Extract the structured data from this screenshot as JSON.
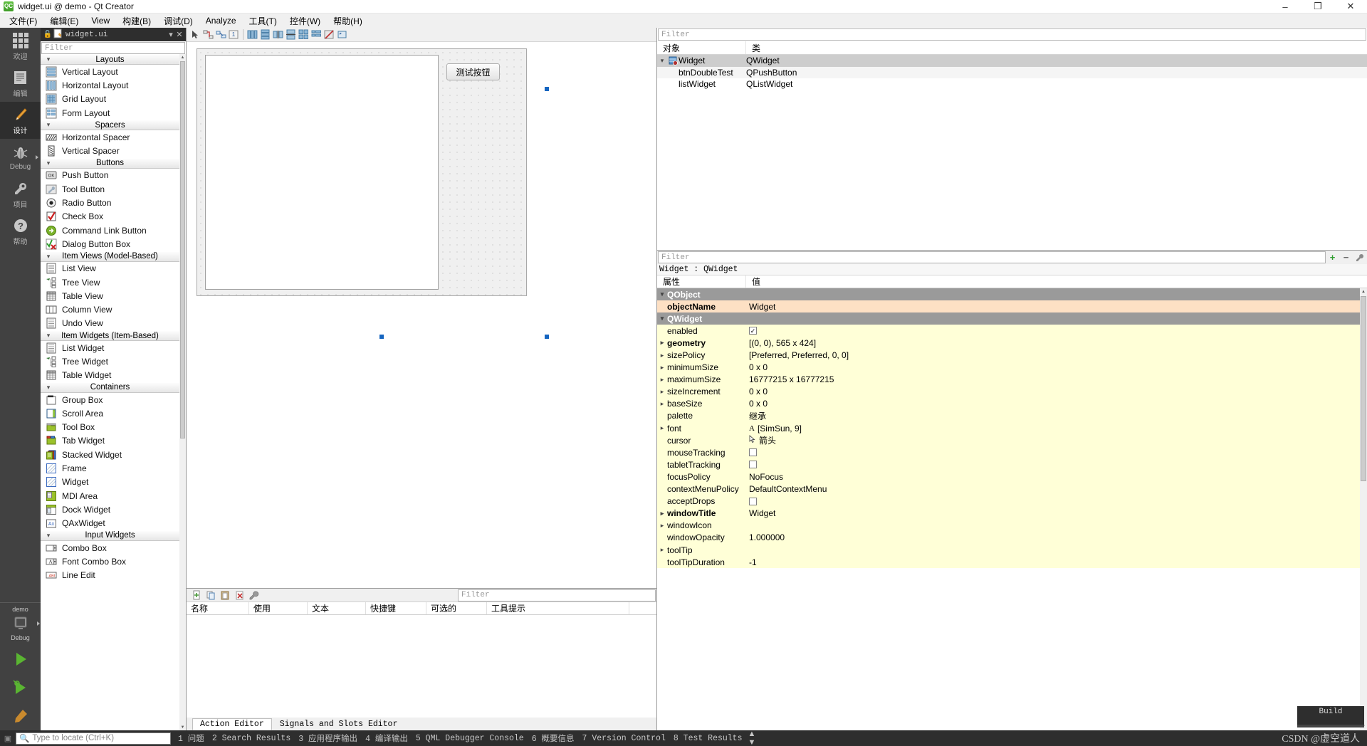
{
  "window": {
    "title": "widget.ui @ demo - Qt Creator",
    "app_icon": "qt-creator-icon",
    "minimize": "–",
    "maximize": "❐",
    "close": "✕"
  },
  "menubar": {
    "items": [
      {
        "label": "文件(F)",
        "name": "menu-file"
      },
      {
        "label": "编辑(E)",
        "name": "menu-edit"
      },
      {
        "label": "View",
        "name": "menu-view"
      },
      {
        "label": "构建(B)",
        "name": "menu-build"
      },
      {
        "label": "调试(D)",
        "name": "menu-debug"
      },
      {
        "label": "Analyze",
        "name": "menu-analyze"
      },
      {
        "label": "工具(T)",
        "name": "menu-tools"
      },
      {
        "label": "控件(W)",
        "name": "menu-widget"
      },
      {
        "label": "帮助(H)",
        "name": "menu-help"
      }
    ]
  },
  "modebar": {
    "items": [
      {
        "label": "欢迎",
        "icon": "grid-icon",
        "active": false,
        "name": "mode-welcome"
      },
      {
        "label": "编辑",
        "icon": "document-icon",
        "active": false,
        "name": "mode-edit"
      },
      {
        "label": "设计",
        "icon": "pencil-icon",
        "active": true,
        "name": "mode-design"
      },
      {
        "label": "Debug",
        "icon": "bug-icon",
        "active": false,
        "arrow": true,
        "name": "mode-debug"
      },
      {
        "label": "项目",
        "icon": "wrench-icon",
        "active": false,
        "name": "mode-projects"
      },
      {
        "label": "帮助",
        "icon": "question-icon",
        "active": false,
        "name": "mode-help"
      }
    ],
    "kit": {
      "project": "demo",
      "config": "Debug"
    }
  },
  "widgetbox": {
    "doc_title": "widget.ui",
    "filter_placeholder": "Filter",
    "lock_icon": "unlock-icon",
    "close_icon": "close-icon",
    "dropdown_icon": "chevron-down-icon",
    "categories": [
      {
        "name": "Layouts",
        "items": [
          {
            "label": "Vertical Layout",
            "icon": "vertical-layout-icon"
          },
          {
            "label": "Horizontal Layout",
            "icon": "horizontal-layout-icon"
          },
          {
            "label": "Grid Layout",
            "icon": "grid-layout-icon"
          },
          {
            "label": "Form Layout",
            "icon": "form-layout-icon"
          }
        ]
      },
      {
        "name": "Spacers",
        "items": [
          {
            "label": "Horizontal Spacer",
            "icon": "horizontal-spacer-icon"
          },
          {
            "label": "Vertical Spacer",
            "icon": "vertical-spacer-icon"
          }
        ]
      },
      {
        "name": "Buttons",
        "items": [
          {
            "label": "Push Button",
            "icon": "push-button-icon"
          },
          {
            "label": "Tool Button",
            "icon": "tool-button-icon"
          },
          {
            "label": "Radio Button",
            "icon": "radio-button-icon"
          },
          {
            "label": "Check Box",
            "icon": "check-box-icon"
          },
          {
            "label": "Command Link Button",
            "icon": "command-link-icon"
          },
          {
            "label": "Dialog Button Box",
            "icon": "dialog-button-box-icon"
          }
        ]
      },
      {
        "name": "Item Views (Model-Based)",
        "items": [
          {
            "label": "List View",
            "icon": "list-view-icon"
          },
          {
            "label": "Tree View",
            "icon": "tree-view-icon"
          },
          {
            "label": "Table View",
            "icon": "table-view-icon"
          },
          {
            "label": "Column View",
            "icon": "column-view-icon"
          },
          {
            "label": "Undo View",
            "icon": "undo-view-icon"
          }
        ]
      },
      {
        "name": "Item Widgets (Item-Based)",
        "items": [
          {
            "label": "List Widget",
            "icon": "list-widget-icon"
          },
          {
            "label": "Tree Widget",
            "icon": "tree-widget-icon"
          },
          {
            "label": "Table Widget",
            "icon": "table-widget-icon"
          }
        ]
      },
      {
        "name": "Containers",
        "items": [
          {
            "label": "Group Box",
            "icon": "group-box-icon"
          },
          {
            "label": "Scroll Area",
            "icon": "scroll-area-icon"
          },
          {
            "label": "Tool Box",
            "icon": "tool-box-icon"
          },
          {
            "label": "Tab Widget",
            "icon": "tab-widget-icon"
          },
          {
            "label": "Stacked Widget",
            "icon": "stacked-widget-icon"
          },
          {
            "label": "Frame",
            "icon": "frame-icon"
          },
          {
            "label": "Widget",
            "icon": "widget-icon"
          },
          {
            "label": "MDI Area",
            "icon": "mdi-area-icon"
          },
          {
            "label": "Dock Widget",
            "icon": "dock-widget-icon"
          },
          {
            "label": "QAxWidget",
            "icon": "qax-widget-icon"
          }
        ]
      },
      {
        "name": "Input Widgets",
        "items": [
          {
            "label": "Combo Box",
            "icon": "combo-box-icon"
          },
          {
            "label": "Font Combo Box",
            "icon": "font-combo-box-icon"
          },
          {
            "label": "Line Edit",
            "icon": "line-edit-icon"
          }
        ]
      }
    ]
  },
  "designer_toolbar": {
    "buttons": [
      {
        "name": "edit-widgets-button",
        "icon": "pointer-icon"
      },
      {
        "name": "edit-signals-slots-button",
        "icon": "signal-slot-icon"
      },
      {
        "name": "edit-buddies-button",
        "icon": "buddy-icon"
      },
      {
        "name": "edit-tab-order-button",
        "icon": "tab-order-icon"
      },
      {
        "name": "layout-horizontally-button",
        "icon": "layout-horizontal-icon"
      },
      {
        "name": "layout-vertically-button",
        "icon": "layout-vertical-icon"
      },
      {
        "name": "layout-horizontal-splitter-button",
        "icon": "splitter-horizontal-icon"
      },
      {
        "name": "layout-vertical-splitter-button",
        "icon": "splitter-vertical-icon"
      },
      {
        "name": "layout-grid-button",
        "icon": "layout-grid-icon"
      },
      {
        "name": "layout-form-button",
        "icon": "layout-form-icon"
      },
      {
        "name": "break-layout-button",
        "icon": "break-layout-icon"
      },
      {
        "name": "adjust-size-button",
        "icon": "adjust-size-icon"
      }
    ]
  },
  "form": {
    "push_button_text": "测试按钮",
    "push_button_object": "btnDoubleTest",
    "list_widget_object": "listWidget"
  },
  "action_editor": {
    "filter_placeholder": "Filter",
    "columns": [
      "名称",
      "使用",
      "文本",
      "快捷键",
      "可选的",
      "工具提示"
    ],
    "tabs": [
      {
        "label": "Action Editor",
        "active": true
      },
      {
        "label": "Signals and Slots Editor",
        "active": false
      }
    ],
    "tools": [
      {
        "name": "new-action-button",
        "icon": "new-action-icon"
      },
      {
        "name": "copy-button",
        "icon": "copy-icon"
      },
      {
        "name": "paste-button",
        "icon": "paste-icon"
      },
      {
        "name": "delete-button",
        "icon": "delete-icon"
      },
      {
        "name": "edit-button",
        "icon": "wrench-icon"
      }
    ]
  },
  "object_inspector": {
    "filter_placeholder": "Filter",
    "columns": [
      "对象",
      "类"
    ],
    "rows": [
      {
        "object": "Widget",
        "class": "QWidget",
        "indent": 0,
        "expanded": true,
        "selected": true,
        "icon": "widget-tree-icon"
      },
      {
        "object": "btnDoubleTest",
        "class": "QPushButton",
        "indent": 1,
        "selected": false
      },
      {
        "object": "listWidget",
        "class": "QListWidget",
        "indent": 1,
        "selected": false
      }
    ]
  },
  "property_editor": {
    "filter_placeholder": "Filter",
    "add_button": "+",
    "remove_button": "−",
    "config_button": "configure-icon",
    "object_line": "Widget : QWidget",
    "columns": [
      "属性",
      "值"
    ],
    "rows": [
      {
        "name": "QObject",
        "value": "",
        "type": "group",
        "expanded": true
      },
      {
        "name": "objectName",
        "value": "Widget",
        "type": "highlight"
      },
      {
        "name": "QWidget",
        "value": "",
        "type": "group",
        "expanded": true
      },
      {
        "name": "enabled",
        "value": "",
        "type": "yellow",
        "widget": "checkbox",
        "checked": true
      },
      {
        "name": "geometry",
        "value": "[(0, 0), 565 x 424]",
        "type": "yellow",
        "bold": true,
        "expandable": true
      },
      {
        "name": "sizePolicy",
        "value": "[Preferred, Preferred, 0, 0]",
        "type": "yellow",
        "expandable": true
      },
      {
        "name": "minimumSize",
        "value": "0 x 0",
        "type": "yellow",
        "expandable": true
      },
      {
        "name": "maximumSize",
        "value": "16777215 x 16777215",
        "type": "yellow",
        "expandable": true
      },
      {
        "name": "sizeIncrement",
        "value": "0 x 0",
        "type": "yellow",
        "expandable": true
      },
      {
        "name": "baseSize",
        "value": "0 x 0",
        "type": "yellow",
        "expandable": true
      },
      {
        "name": "palette",
        "value": "继承",
        "type": "yellow"
      },
      {
        "name": "font",
        "value": "[SimSun, 9]",
        "type": "yellow",
        "expandable": true,
        "widget": "font"
      },
      {
        "name": "cursor",
        "value": "箭头",
        "type": "yellow",
        "widget": "cursor"
      },
      {
        "name": "mouseTracking",
        "value": "",
        "type": "yellow",
        "widget": "checkbox",
        "checked": false
      },
      {
        "name": "tabletTracking",
        "value": "",
        "type": "yellow",
        "widget": "checkbox",
        "checked": false
      },
      {
        "name": "focusPolicy",
        "value": "NoFocus",
        "type": "yellow"
      },
      {
        "name": "contextMenuPolicy",
        "value": "DefaultContextMenu",
        "type": "yellow"
      },
      {
        "name": "acceptDrops",
        "value": "",
        "type": "yellow",
        "widget": "checkbox",
        "checked": false
      },
      {
        "name": "windowTitle",
        "value": "Widget",
        "type": "yellow",
        "bold": true,
        "expandable": true
      },
      {
        "name": "windowIcon",
        "value": "",
        "type": "yellow",
        "expandable": true
      },
      {
        "name": "windowOpacity",
        "value": "1.000000",
        "type": "yellow"
      },
      {
        "name": "toolTip",
        "value": "",
        "type": "yellow",
        "expandable": true
      },
      {
        "name": "toolTipDuration",
        "value": "-1",
        "type": "yellow"
      }
    ]
  },
  "statusbar": {
    "locator_placeholder": "Type to locate (Ctrl+K)",
    "search_icon": "search-icon",
    "items": [
      {
        "num": "1",
        "label": "问题"
      },
      {
        "num": "2",
        "label": "Search Results"
      },
      {
        "num": "3",
        "label": "应用程序输出"
      },
      {
        "num": "4",
        "label": "编译输出"
      },
      {
        "num": "5",
        "label": "QML Debugger Console"
      },
      {
        "num": "6",
        "label": "概要信息"
      },
      {
        "num": "7",
        "label": "Version Control"
      },
      {
        "num": "8",
        "label": "Test Results"
      }
    ],
    "updown_icon": "up-down-arrows-icon",
    "watermark": "CSDN @虚空道人"
  },
  "build_popup": {
    "label": "Build"
  },
  "colors": {
    "accent": "#1565c0",
    "dark_panel": "#2e2e2e",
    "mode_bar": "#414141",
    "group_row": "#9a9a9a",
    "highlight_row": "#fde0c4",
    "yellow_row": "#ffffd7",
    "selected_row": "#cdcdcd"
  }
}
